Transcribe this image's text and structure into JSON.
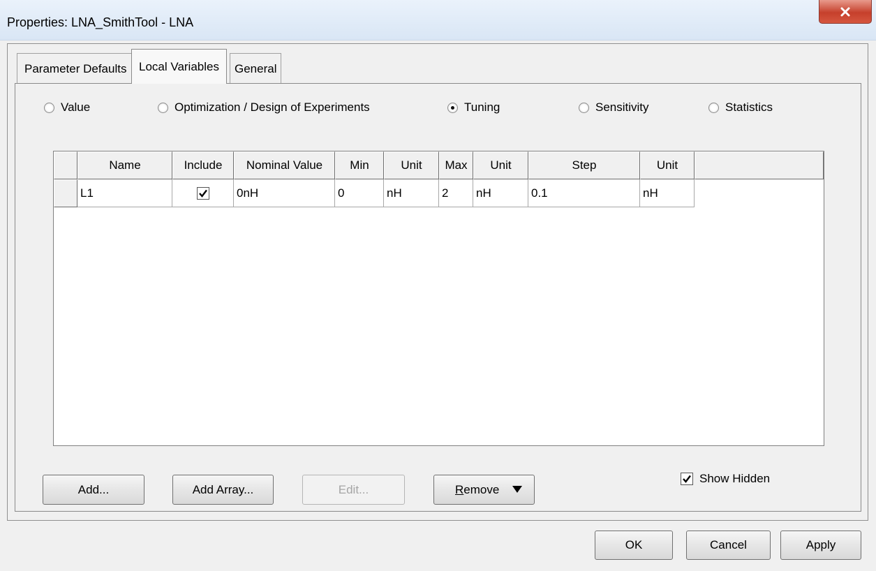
{
  "window": {
    "title": "Properties: LNA_SmithTool - LNA"
  },
  "tabs": [
    {
      "label": "Parameter Defaults",
      "active": false
    },
    {
      "label": "Local Variables",
      "active": true
    },
    {
      "label": "General",
      "active": false
    }
  ],
  "mode_options": [
    {
      "label": "Value",
      "selected": false
    },
    {
      "label": "Optimization / Design of Experiments",
      "selected": false
    },
    {
      "label": "Tuning",
      "selected": true
    },
    {
      "label": "Sensitivity",
      "selected": false
    },
    {
      "label": "Statistics",
      "selected": false
    }
  ],
  "table": {
    "columns": [
      "Name",
      "Include",
      "Nominal Value",
      "Min",
      "Unit",
      "Max",
      "Unit",
      "Step",
      "Unit"
    ],
    "rows": [
      {
        "name": "L1",
        "include": true,
        "nominal_value": "0nH",
        "min": "0",
        "min_unit": "nH",
        "max": "2",
        "max_unit": "nH",
        "step": "0.1",
        "step_unit": "nH"
      }
    ]
  },
  "buttons": {
    "add": "Add...",
    "add_array": "Add Array...",
    "edit": "Edit...",
    "remove_underlined": "R",
    "remove_rest": "emove",
    "ok": "OK",
    "cancel": "Cancel",
    "apply": "Apply"
  },
  "show_hidden": {
    "label": "Show Hidden",
    "checked": true
  },
  "colors": {
    "close_button": "#c6402c",
    "title_bar": "#d9e6f5",
    "dialog_background": "#f0f0f0"
  }
}
